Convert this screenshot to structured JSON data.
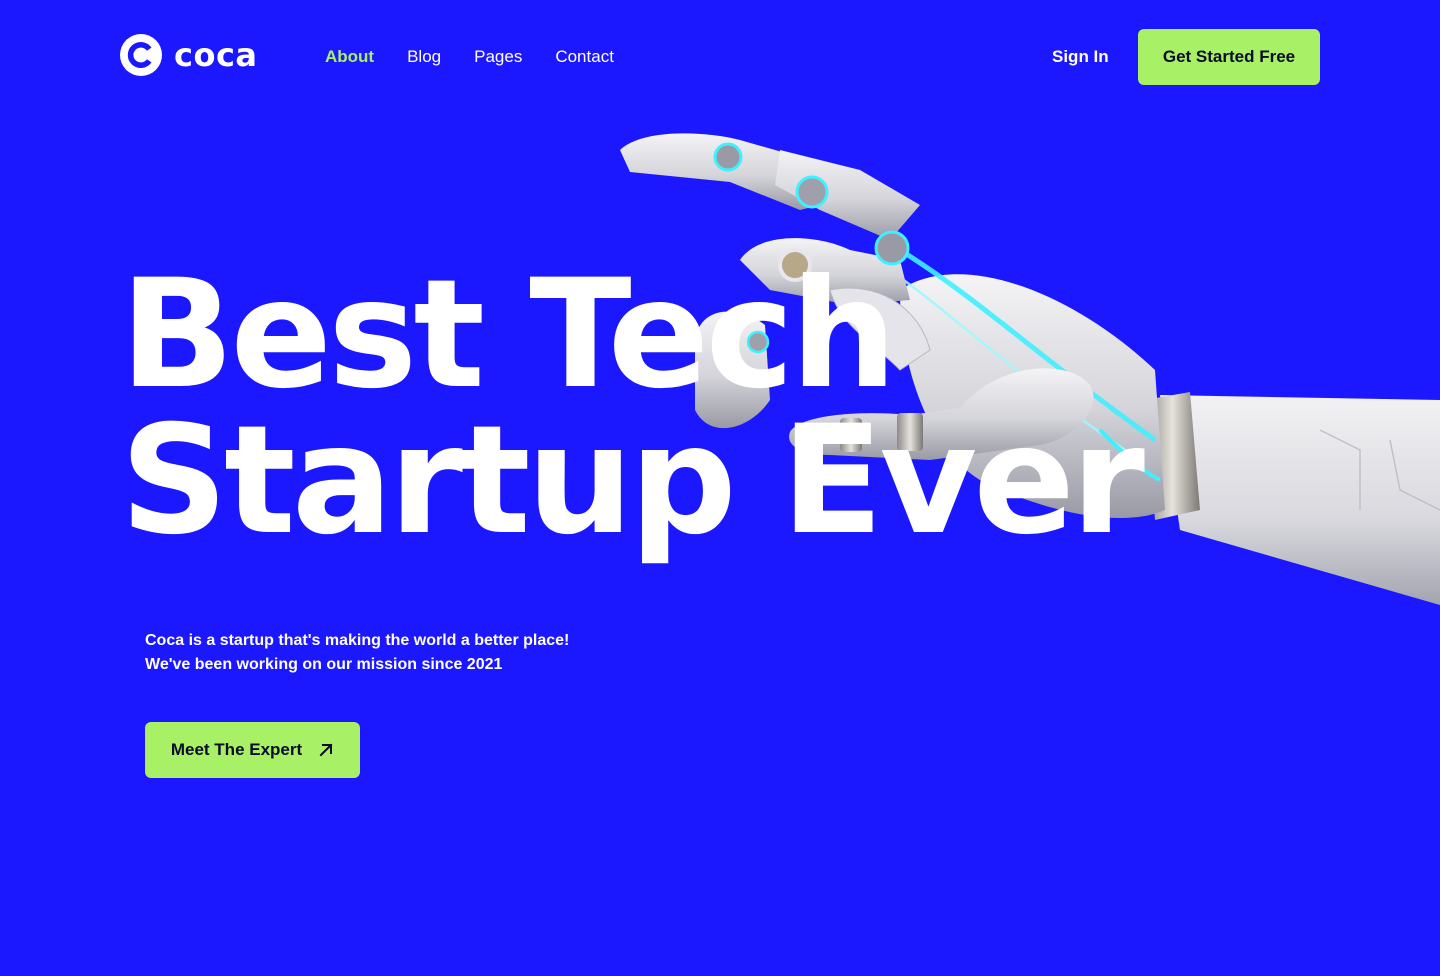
{
  "brand": {
    "name": "coca",
    "logo_icon": "c-logo-icon",
    "primary_color": "#1b18ff",
    "accent_color": "#a8f065"
  },
  "nav": {
    "items": [
      {
        "label": "About",
        "active": true
      },
      {
        "label": "Blog",
        "active": false
      },
      {
        "label": "Pages",
        "active": false
      },
      {
        "label": "Contact",
        "active": false
      }
    ]
  },
  "header": {
    "sign_in_label": "Sign In",
    "cta_label": "Get Started Free"
  },
  "hero": {
    "title_line1": "Best Tech",
    "title_line2": "Startup Ever",
    "subtitle_line1": "Coca is a startup that's making the world a better place!",
    "subtitle_line2": "We've been working on our mission since 2021",
    "cta_label": "Meet The Expert",
    "cta_icon": "arrow-up-right-icon",
    "image": "robot-hand-image"
  }
}
